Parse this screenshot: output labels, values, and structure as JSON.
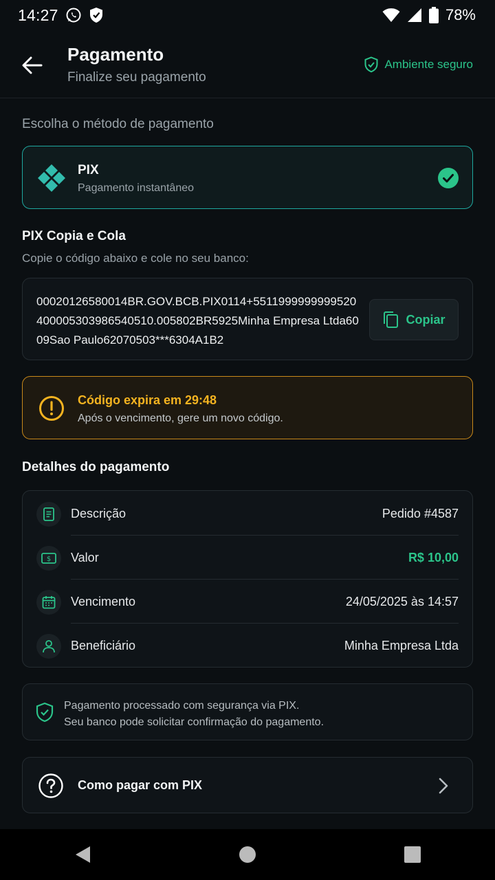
{
  "status_bar": {
    "time": "14:27",
    "battery": "78%",
    "icons": [
      "whatsapp-icon",
      "shield-notification-icon",
      "wifi-icon",
      "signal-icon",
      "battery-icon"
    ]
  },
  "header": {
    "title": "Pagamento",
    "subtitle": "Finalize seu pagamento",
    "secure_label": "Ambiente seguro"
  },
  "method_section": {
    "label": "Escolha o método de pagamento",
    "method": {
      "name": "PIX",
      "description": "Pagamento instantâneo",
      "selected": true
    }
  },
  "pix_copy": {
    "title": "PIX Copia e Cola",
    "hint": "Copie o código abaixo e cole no seu banco:",
    "code": "00020126580014BR.GOV.BCB.PIX0114+5511999999999520400005303986540510.005802BR5925Minha Empresa Ltda6009Sao Paulo62070503***6304A1B2",
    "copy_label": "Copiar"
  },
  "expiry": {
    "title": "Código expira em 29:48",
    "description": "Após o vencimento, gere um novo código."
  },
  "details": {
    "title": "Detalhes do pagamento",
    "rows": [
      {
        "label": "Descrição",
        "value": "Pedido #4587",
        "icon": "document-icon"
      },
      {
        "label": "Valor",
        "value": "R$ 10,00",
        "icon": "money-icon"
      },
      {
        "label": "Vencimento",
        "value": "24/05/2025 às 14:57",
        "icon": "calendar-icon"
      },
      {
        "label": "Beneficiário",
        "value": "Minha Empresa Ltda",
        "icon": "user-icon"
      }
    ]
  },
  "security_note": {
    "line1": "Pagamento processado com segurança via PIX.",
    "line2": "Seu banco pode solicitar confirmação do pagamento."
  },
  "help": {
    "label": "Como pagar com PIX"
  },
  "colors": {
    "background": "#0b0f12",
    "accent_green": "#2bc48a",
    "pix_teal": "#32bcad",
    "warning": "#f4b320",
    "card": "#0f1418"
  }
}
